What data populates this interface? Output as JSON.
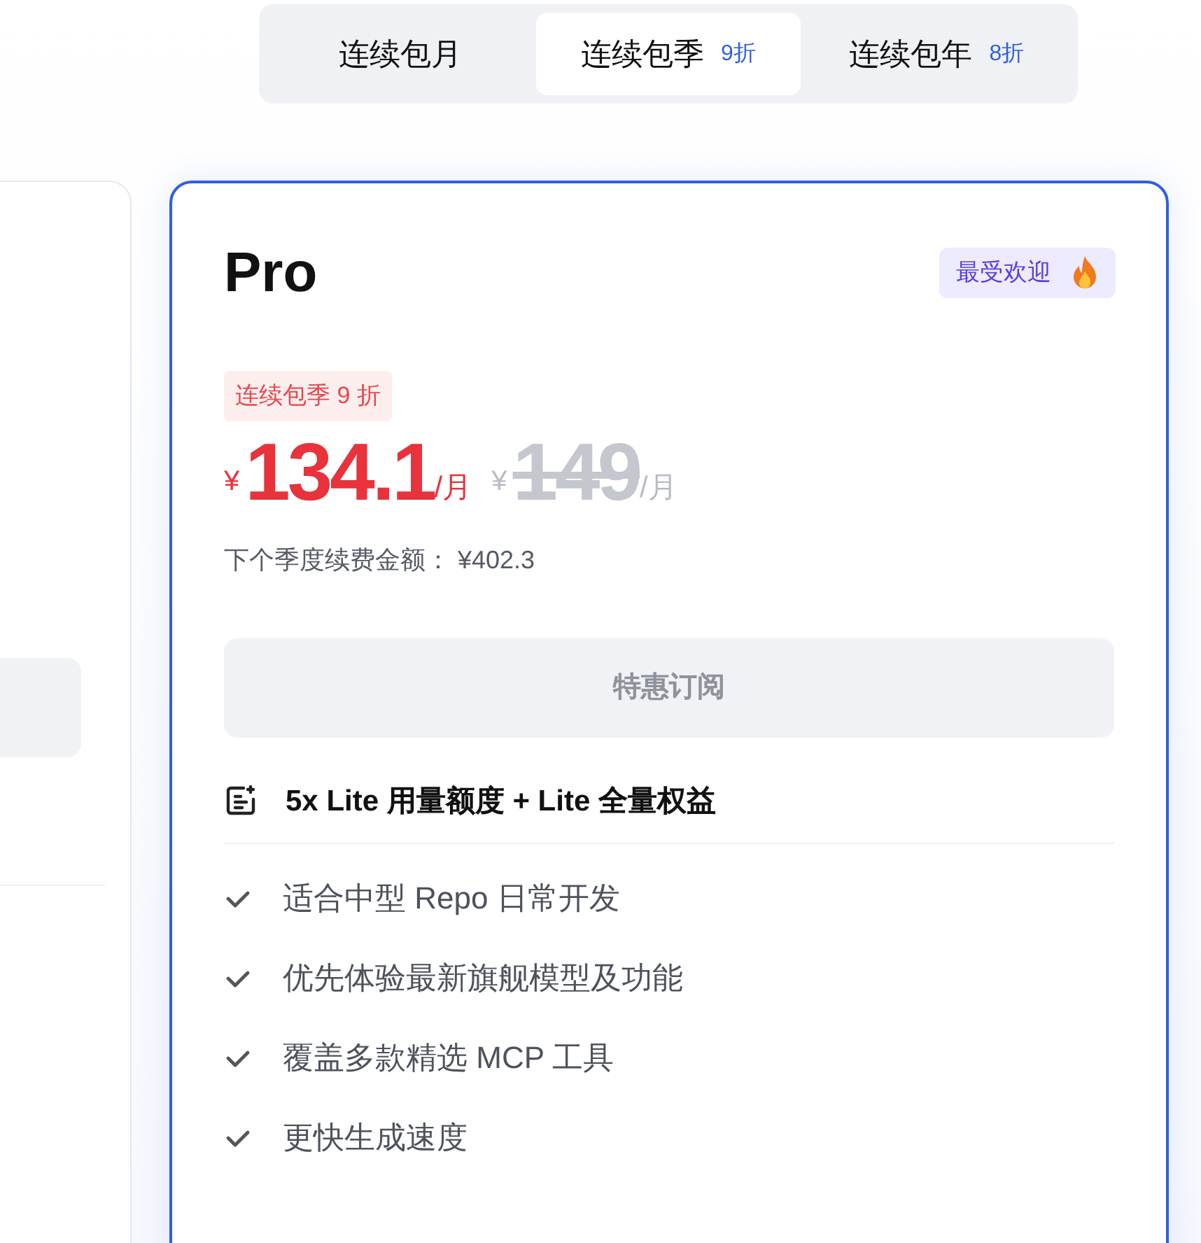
{
  "tabs": [
    {
      "label": "连续包月",
      "selected": false
    },
    {
      "label": "连续包季",
      "badge": "9折",
      "selected": true
    },
    {
      "label": "连续包年",
      "badge": "8折",
      "selected": false
    }
  ],
  "plan": {
    "name": "Pro",
    "highlighted": true,
    "tag": "最受欢迎",
    "discount_tag": "连续包季 9 折",
    "currency": "¥",
    "price": "134.1",
    "unit": "/月",
    "old_currency": "¥",
    "old_price": "149",
    "old_unit": "/月",
    "renewal_label": "下个季度续费金额：",
    "renewal_amount": "¥402.3",
    "button": "特惠订阅",
    "button_disabled": true,
    "headline": "5x Lite 用量额度 + Lite 全量权益",
    "features": [
      "适合中型 Repo 日常开发",
      "优先体验最新旗舰模型及功能",
      "覆盖多款精选 MCP 工具",
      "更快生成速度"
    ]
  }
}
